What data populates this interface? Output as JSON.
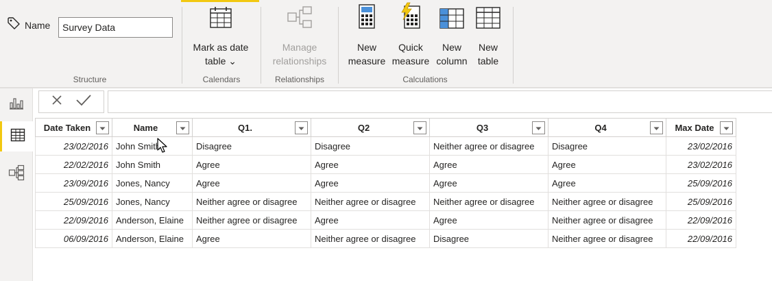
{
  "ribbon": {
    "structure": {
      "name_label": "Name",
      "name_value": "Survey Data",
      "group_label": "Structure"
    },
    "calendars": {
      "mark_as_date_table": {
        "line1": "Mark as date",
        "line2": "table ⌄"
      },
      "group_label": "Calendars"
    },
    "relationships": {
      "manage_relationships": {
        "line1": "Manage",
        "line2": "relationships"
      },
      "group_label": "Relationships"
    },
    "calculations": {
      "new_measure": {
        "line1": "New",
        "line2": "measure"
      },
      "quick_measure": {
        "line1": "Quick",
        "line2": "measure"
      },
      "new_column": {
        "line1": "New",
        "line2": "column"
      },
      "new_table": {
        "line1": "New",
        "line2": "table"
      },
      "group_label": "Calculations"
    }
  },
  "table": {
    "columns": [
      "Date Taken",
      "Name",
      "Q1.",
      "Q2",
      "Q3",
      "Q4",
      "Max Date"
    ],
    "rows": [
      [
        "23/02/2016",
        "John Smith",
        "Disagree",
        "Disagree",
        "Neither agree or disagree",
        "Disagree",
        "23/02/2016"
      ],
      [
        "22/02/2016",
        "John Smith",
        "Agree",
        "Agree",
        "Agree",
        "Agree",
        "23/02/2016"
      ],
      [
        "23/09/2016",
        "Jones, Nancy",
        "Agree",
        "Agree",
        "Agree",
        "Agree",
        "25/09/2016"
      ],
      [
        "25/09/2016",
        "Jones, Nancy",
        "Neither agree or disagree",
        "Neither agree or disagree",
        "Neither agree or disagree",
        "Neither agree or disagree",
        "25/09/2016"
      ],
      [
        "22/09/2016",
        "Anderson, Elaine",
        "Neither agree or disagree",
        "Agree",
        "Agree",
        "Neither agree or disagree",
        "22/09/2016"
      ],
      [
        "06/09/2016",
        "Anderson, Elaine",
        "Agree",
        "Neither agree or disagree",
        "Disagree",
        "Neither agree or disagree",
        "22/09/2016"
      ]
    ]
  },
  "colors": {
    "accent": "#f2c811",
    "ribbon_bg": "#f3f2f1",
    "icon_blue": "#4a90d9",
    "icon_dark": "#252423"
  },
  "icons": {
    "tag": "tag-icon",
    "calendar": "calendar-table-icon",
    "relationships": "manage-relationships-icon",
    "measure": "calculator-icon",
    "quick_measure": "lightning-calculator-icon",
    "column": "column-grid-icon",
    "table": "table-grid-icon",
    "report_view": "bar-chart-icon",
    "data_view": "table-icon",
    "model_view": "model-icon"
  }
}
